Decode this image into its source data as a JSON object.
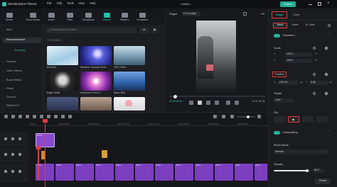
{
  "app": {
    "title": "Wondershare Filmora",
    "project_title": "Untitled",
    "export_label": "Export"
  },
  "menu": [
    "File",
    "Edit",
    "Tools",
    "View",
    "Help"
  ],
  "asset_tabs": [
    {
      "label": "Media",
      "icon": "media-icon"
    },
    {
      "label": "Stock Media",
      "icon": "stock-media-icon"
    },
    {
      "label": "Audio",
      "icon": "audio-icon"
    },
    {
      "label": "Titles",
      "icon": "titles-icon"
    },
    {
      "label": "Transitions",
      "icon": "transitions-icon"
    },
    {
      "label": "Effects",
      "icon": "effects-icon",
      "active": true
    },
    {
      "label": "Stickers",
      "icon": "stickers-icon"
    },
    {
      "label": "Templates",
      "icon": "templates-icon"
    }
  ],
  "left_nav": [
    {
      "label": "Mine"
    },
    {
      "label": "Recommended",
      "selected": true
    },
    {
      "label": "Trending"
    },
    {
      "label": "Overlay"
    },
    {
      "label": "Video Effects"
    },
    {
      "label": "Body Effects"
    },
    {
      "label": "Filters"
    },
    {
      "label": "Overlay"
    },
    {
      "label": "FilterBLUT"
    }
  ],
  "browser": {
    "search_placeholder": "Search effects & filters",
    "filter_label": "All",
    "section_label": "TRENDING",
    "thumbs": [
      {
        "label": "Extreme",
        "color": "#cfe6f3"
      },
      {
        "label": "Weather Overlay Pack ...",
        "color": "#3b3fb6"
      },
      {
        "label": "VHS Glitch",
        "color": "#9fb8c9"
      },
      {
        "label": "Edge Scale",
        "color": "#1d1d1d"
      },
      {
        "label": "Iridescent Circle 2",
        "color": "#c85ac1"
      },
      {
        "label": "Basic Blur",
        "color": "#3a6fb8"
      },
      {
        "label": "",
        "color": "#3e4a66"
      },
      {
        "label": "",
        "color": "#9e8a7d"
      },
      {
        "label": "",
        "color": "#e8e9ea"
      }
    ]
  },
  "player": {
    "tab_label": "Player",
    "quality_label": "Full Quality",
    "time_current": "00:00:00:20",
    "time_total": "00:01:32:08"
  },
  "inspector": {
    "tabs": [
      "Image",
      "Color"
    ],
    "subtabs": [
      "Basic",
      "Mask",
      "AI Tools"
    ],
    "transform_label": "Transform",
    "scale_label": "Scale",
    "scale_x": "100.0",
    "scale_y": "100.0",
    "unit_percent": "%",
    "position_label": "Position",
    "pos_x": "-270.00",
    "pos_y": "0.00",
    "pos_unit": "px",
    "rotate_label": "Rotate",
    "rotate_value": "0.00°",
    "flip_label": "Flip",
    "compositing_label": "Compositing",
    "blend_label": "Blend Mode",
    "blend_value": "Normal",
    "opacity_label": "Opacity",
    "opacity_value": "89.2",
    "reset_label": "Reset",
    "accent": "#20b6a0",
    "highlight": "#e23b3b"
  },
  "timeline": {
    "ruler": [
      "00:00",
      "00:00:05:00",
      "00:00:10:00",
      "00:00:15:00",
      "00:00:20:00",
      "00:00:25:00",
      "00:00:30:00",
      "00:00:35:00"
    ],
    "clip_label": "2024..."
  }
}
